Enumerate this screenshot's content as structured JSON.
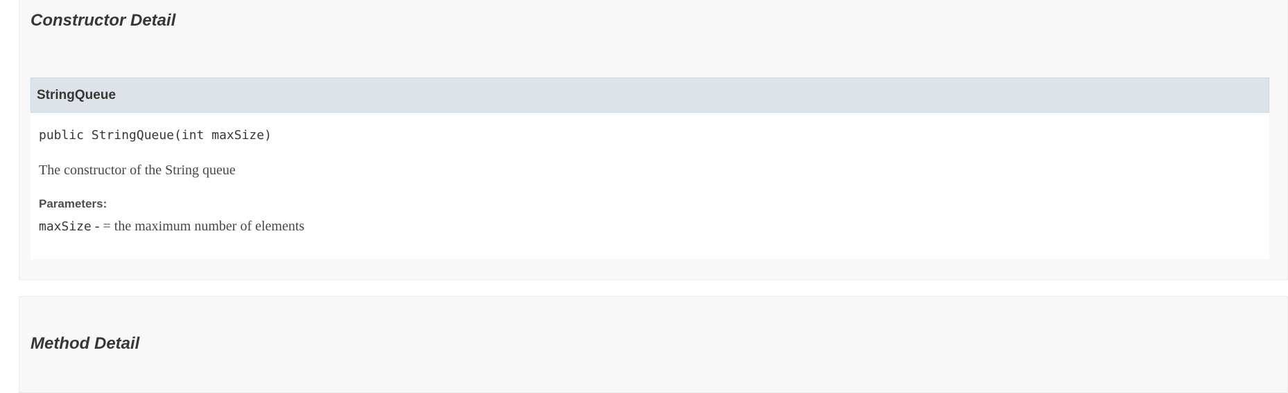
{
  "constructor_section": {
    "title": "Constructor Detail",
    "member": {
      "name": "StringQueue",
      "signature": "public StringQueue(int maxSize)",
      "description": "The constructor of the String queue",
      "parameters_label": "Parameters:",
      "parameters": [
        {
          "name": "maxSize",
          "separator": " - ",
          "description": "= the maximum number of elements"
        }
      ]
    }
  },
  "method_section": {
    "title": "Method Detail"
  }
}
